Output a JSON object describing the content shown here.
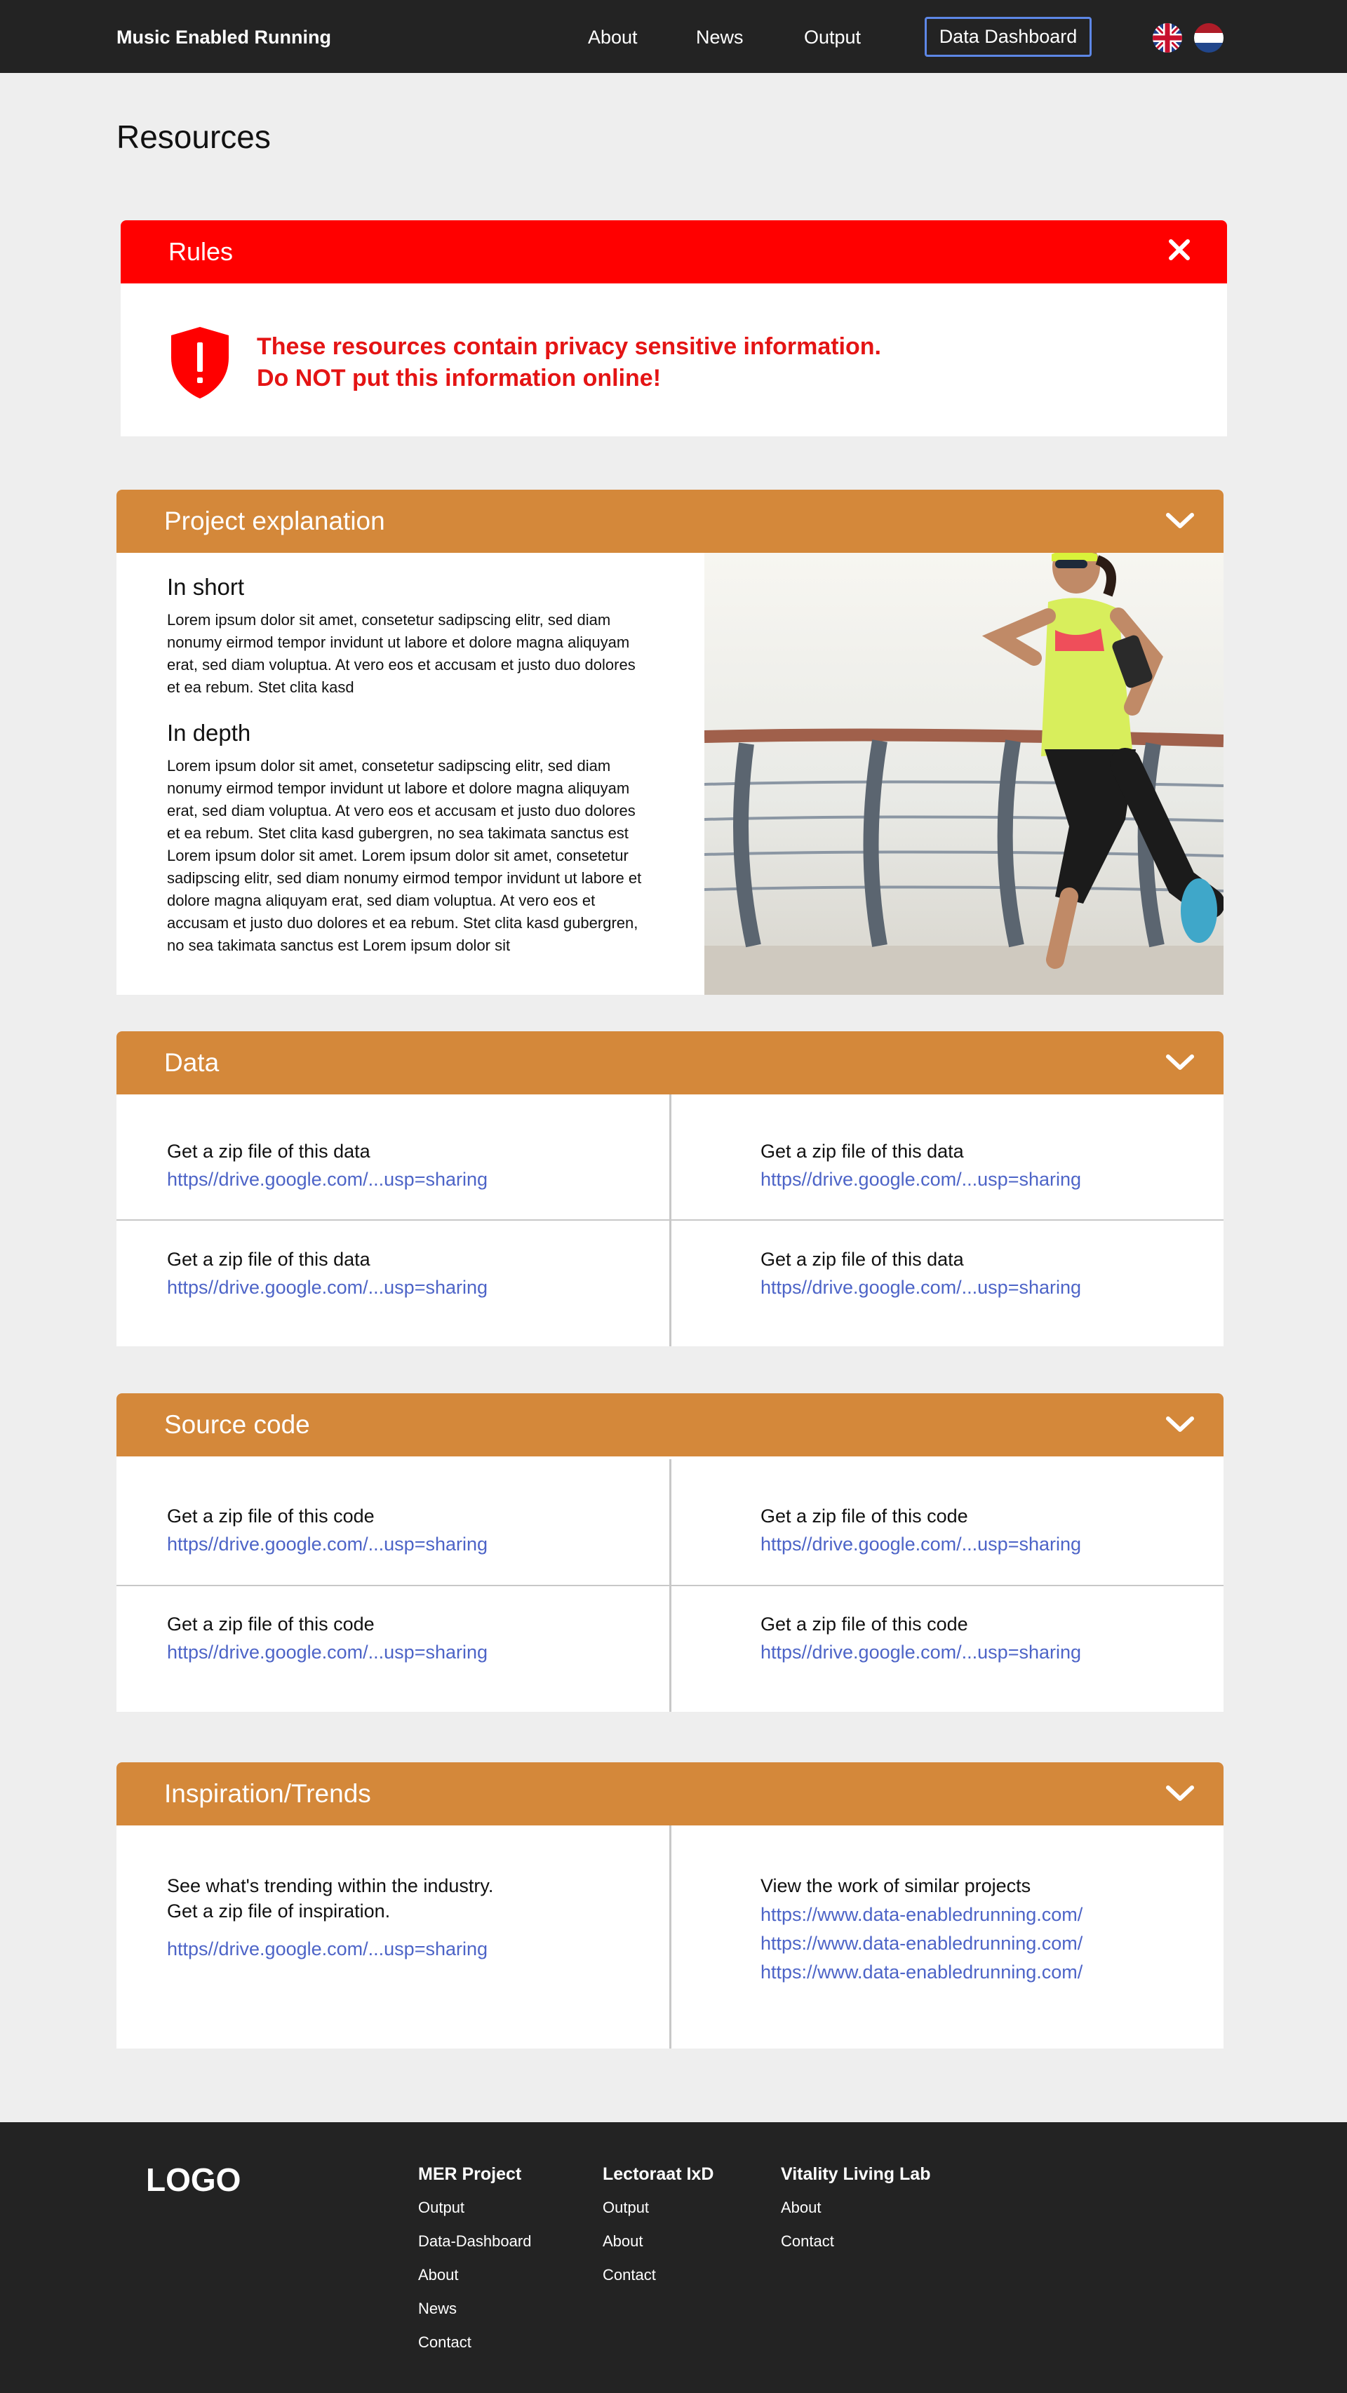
{
  "header": {
    "brand": "Music Enabled Running",
    "nav": [
      "About",
      "News",
      "Output"
    ],
    "dashboard_button": "Data Dashboard",
    "languages": [
      "uk-flag-icon",
      "nl-flag-icon"
    ]
  },
  "page": {
    "title": "Resources"
  },
  "rules": {
    "title": "Rules",
    "close_icon": "close-icon",
    "line1": "These resources contain privacy sensitive information.",
    "line2": "Do NOT put this information online!",
    "color": "#ff0000"
  },
  "project": {
    "title": "Project explanation",
    "short_heading": "In short",
    "short_text": "Lorem ipsum dolor sit amet, consetetur sadipscing elitr, sed diam nonumy eirmod tempor invidunt ut labore et dolore magna aliquyam erat, sed diam voluptua. At vero eos et accusam et justo duo dolores et ea rebum. Stet clita kasd",
    "depth_heading": "In depth",
    "depth_text": "Lorem ipsum dolor sit amet, consetetur sadipscing elitr, sed diam nonumy eirmod tempor invidunt ut labore et dolore magna aliquyam erat, sed diam voluptua. At vero eos et accusam et justo duo dolores et ea rebum. Stet clita kasd gubergren, no sea takimata sanctus est Lorem ipsum dolor sit amet. Lorem ipsum dolor sit amet, consetetur sadipscing elitr, sed diam nonumy eirmod tempor invidunt ut labore et dolore magna aliquyam erat, sed diam voluptua. At vero eos et accusam et justo duo dolores et ea rebum. Stet clita kasd gubergren, no sea takimata sanctus est Lorem ipsum dolor sit"
  },
  "data": {
    "title": "Data",
    "items": [
      {
        "label": "Get a zip file of this data",
        "link": "https//drive.google.com/...usp=sharing"
      },
      {
        "label": "Get a zip file of this data",
        "link": "https//drive.google.com/...usp=sharing"
      },
      {
        "label": "Get a zip file of this data",
        "link": "https//drive.google.com/...usp=sharing"
      },
      {
        "label": "Get a zip file of this data",
        "link": "https//drive.google.com/...usp=sharing"
      }
    ]
  },
  "source": {
    "title": "Source code",
    "items": [
      {
        "label": "Get a zip file of this code",
        "link": "https//drive.google.com/...usp=sharing"
      },
      {
        "label": "Get a zip file of this code",
        "link": "https//drive.google.com/...usp=sharing"
      },
      {
        "label": "Get a zip file of this code",
        "link": "https//drive.google.com/...usp=sharing"
      },
      {
        "label": "Get a zip file of this code",
        "link": "https//drive.google.com/...usp=sharing"
      }
    ]
  },
  "inspiration": {
    "title": "Inspiration/Trends",
    "left_line1": "See what's trending within the industry.",
    "left_line2": "Get a zip file of inspiration.",
    "left_link": "https//drive.google.com/...usp=sharing",
    "right_heading": "View the work of similar projects",
    "right_links": [
      "https://www.data-enabledrunning.com/",
      "https://www.data-enabledrunning.com/",
      "https://www.data-enabledrunning.com/"
    ]
  },
  "footer": {
    "logo": "LOGO",
    "columns": [
      {
        "heading": "MER Project",
        "links": [
          "Output",
          "Data-Dashboard",
          "About",
          "News",
          "Contact"
        ]
      },
      {
        "heading": "Lectoraat IxD",
        "links": [
          "Output",
          "About",
          "Contact"
        ]
      },
      {
        "heading": "Vitality Living Lab",
        "links": [
          "About",
          "Contact"
        ]
      }
    ]
  },
  "colors": {
    "accent": "#d4883a",
    "link": "#4d64c7",
    "dark": "#232323"
  }
}
